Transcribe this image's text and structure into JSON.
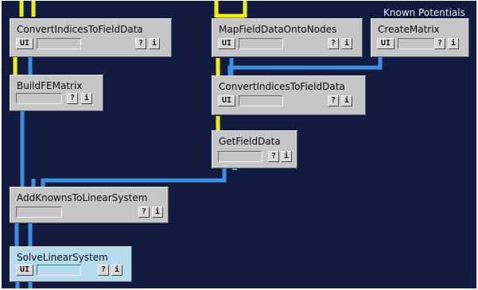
{
  "network": {
    "label": "Known Potentials",
    "colors": {
      "background": "#131a3f",
      "module": "#c6c6c6",
      "module_selected": "#b5dbed",
      "pipe_field": "#3d8fe0",
      "pipe_index": "#f2f200",
      "pipe_matrix": "#3d8fe0"
    },
    "modules": [
      {
        "id": "convert_top",
        "title": "ConvertIndicesToFieldData",
        "ui": "UI",
        "help": "?",
        "info": "i",
        "has_ui": true
      },
      {
        "id": "build_fe",
        "title": "BuildFEMatrix",
        "ui": "",
        "help": "?",
        "info": "i",
        "has_ui": false
      },
      {
        "id": "map_field",
        "title": "MapFieldDataOntoNodes",
        "ui": "UI",
        "help": "?",
        "info": "i",
        "has_ui": true
      },
      {
        "id": "create_matrix",
        "title": "CreateMatrix",
        "ui": "UI",
        "help": "?",
        "info": "i",
        "has_ui": true
      },
      {
        "id": "convert_mid",
        "title": "ConvertIndicesToFieldData",
        "ui": "UI",
        "help": "?",
        "info": "i",
        "has_ui": true
      },
      {
        "id": "get_field",
        "title": "GetFieldData",
        "ui": "",
        "help": "?",
        "info": "i",
        "has_ui": false
      },
      {
        "id": "add_knowns",
        "title": "AddKnownsToLinearSystem",
        "ui": "",
        "help": "?",
        "info": "i",
        "has_ui": false
      },
      {
        "id": "solve",
        "title": "SolveLinearSystem",
        "ui": "UI",
        "help": "?",
        "info": "i",
        "has_ui": true,
        "selected": true
      }
    ]
  }
}
